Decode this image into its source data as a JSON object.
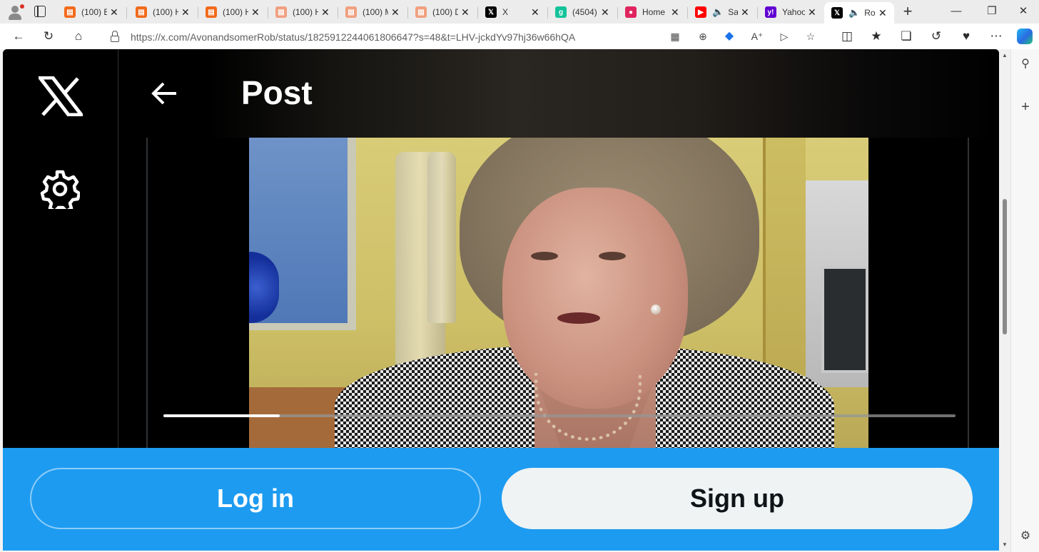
{
  "browser": {
    "tabs": [
      {
        "label": "(100) E",
        "favicon": "substack-icon",
        "color": "#f26a1b"
      },
      {
        "label": "(100) H",
        "favicon": "substack-icon",
        "color": "#f26a1b"
      },
      {
        "label": "(100) H",
        "favicon": "substack-icon",
        "color": "#f26a1b"
      },
      {
        "label": "(100) H",
        "favicon": "substack-icon",
        "color": "#f0a080"
      },
      {
        "label": "(100) M",
        "favicon": "substack-icon",
        "color": "#f0a080"
      },
      {
        "label": "(100) D",
        "favicon": "substack-icon",
        "color": "#f0a080"
      },
      {
        "label": "X",
        "favicon": "x-icon",
        "color": "#000000"
      },
      {
        "label": "(4504)",
        "favicon": "g-icon",
        "color": "#15c39a"
      },
      {
        "label": "Home",
        "favicon": "home-icon",
        "color": "#e0245e"
      },
      {
        "label": "Sa",
        "favicon": "youtube-icon",
        "color": "#ff0000"
      },
      {
        "label": "Yahoo",
        "favicon": "yahoo-icon",
        "color": "#6001d2"
      },
      {
        "label": "Ro",
        "favicon": "x-icon",
        "color": "#000000",
        "active": true
      }
    ],
    "url": "https://x.com/AvonandsomerRob/status/1825912244061806647?s=48&t=LHV-jckdYv97hj36w66hQA"
  },
  "page": {
    "title": "Post",
    "video": {
      "progress": 0.147
    },
    "login_label": "Log in",
    "signup_label": "Sign up"
  },
  "colors": {
    "accent": "#1d9bf0",
    "background": "#000000",
    "signup_bg": "#eff3f4"
  }
}
